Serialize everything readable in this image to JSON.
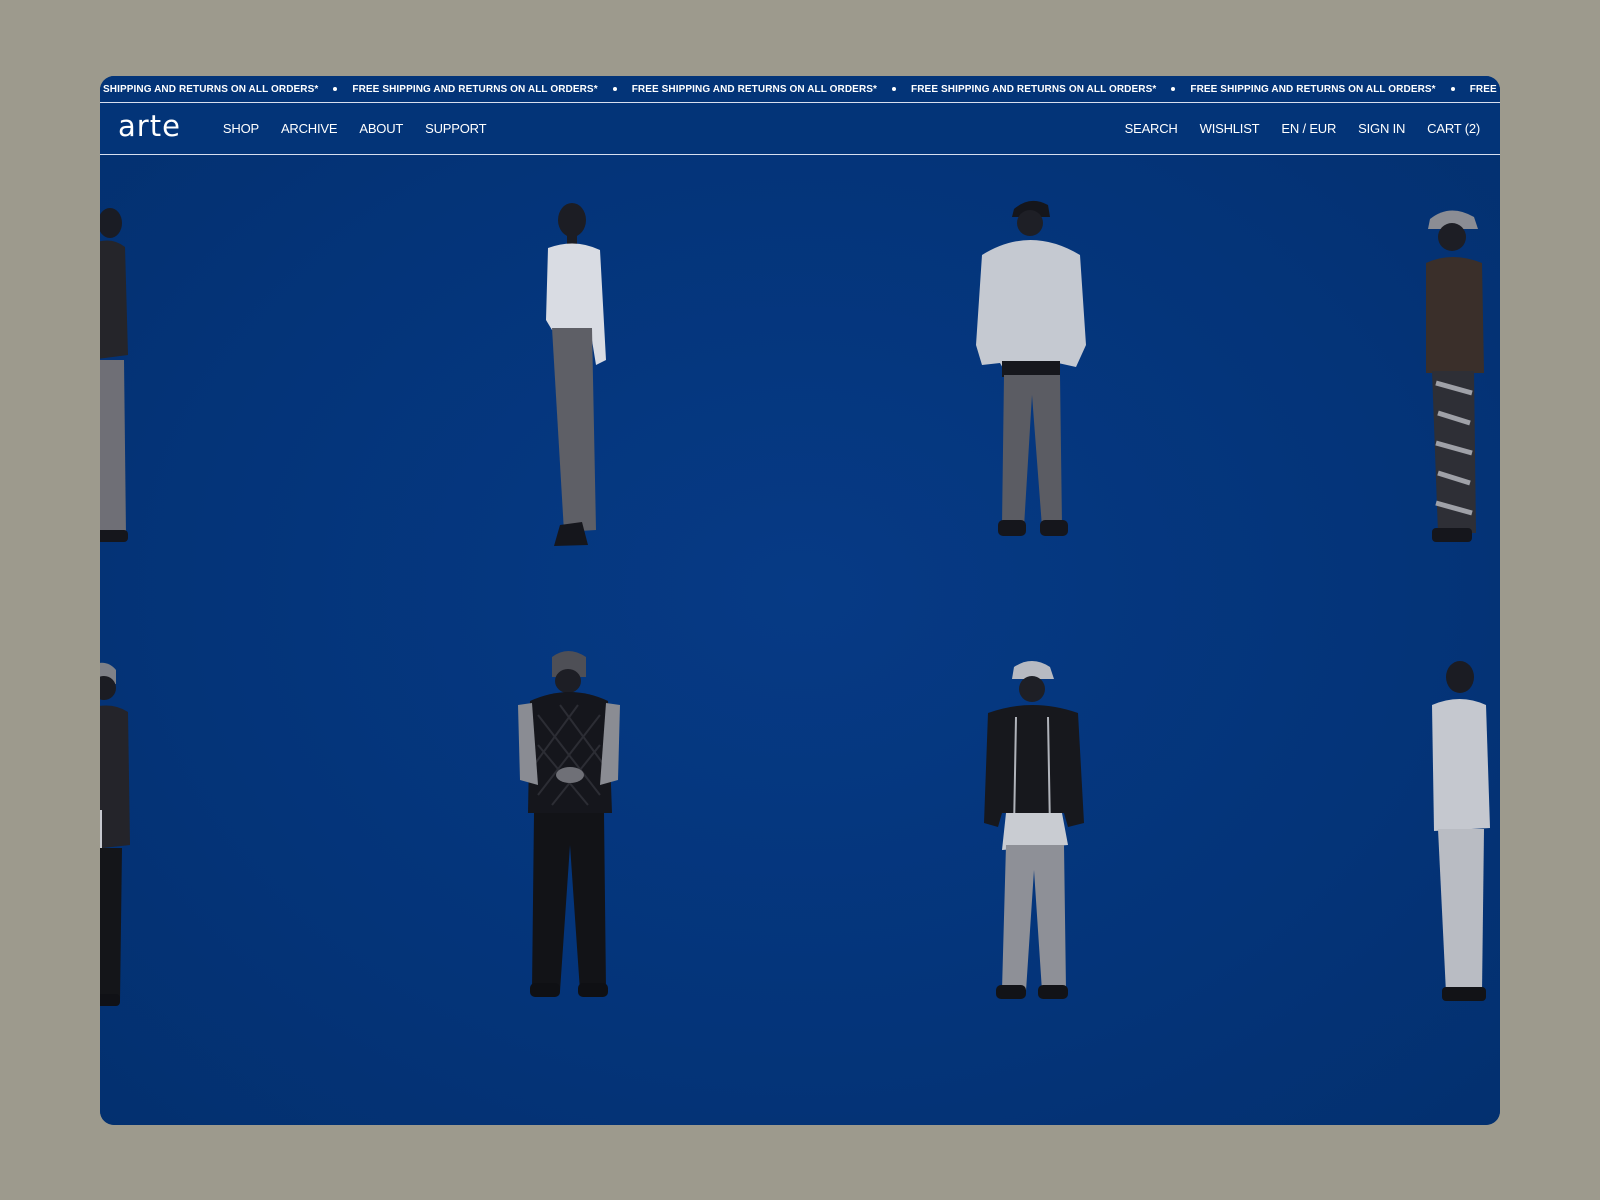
{
  "ticker": {
    "items": [
      "SHIPPING AND RETURNS ON ALL ORDERS*",
      "FREE SHIPPING AND RETURNS ON ALL ORDERS*",
      "FREE SHIPPING AND RETURNS ON ALL ORDERS*",
      "FREE SHIPPING AND RETURNS ON ALL ORDERS*",
      "FREE SHIPPING AND RETURNS ON ALL ORDERS*",
      "FREE SHIPPING AND RETURNS ON"
    ]
  },
  "header": {
    "logo": "arte",
    "nav_left": [
      "SHOP",
      "ARCHIVE",
      "ABOUT",
      "SUPPORT"
    ],
    "nav_right": [
      "SEARCH",
      "WISHLIST",
      "EN / EUR",
      "SIGN IN",
      "CART (2)"
    ]
  },
  "colors": {
    "brand_blue": "#033478",
    "page_background": "#9d9a8d",
    "text": "#ffffff"
  }
}
